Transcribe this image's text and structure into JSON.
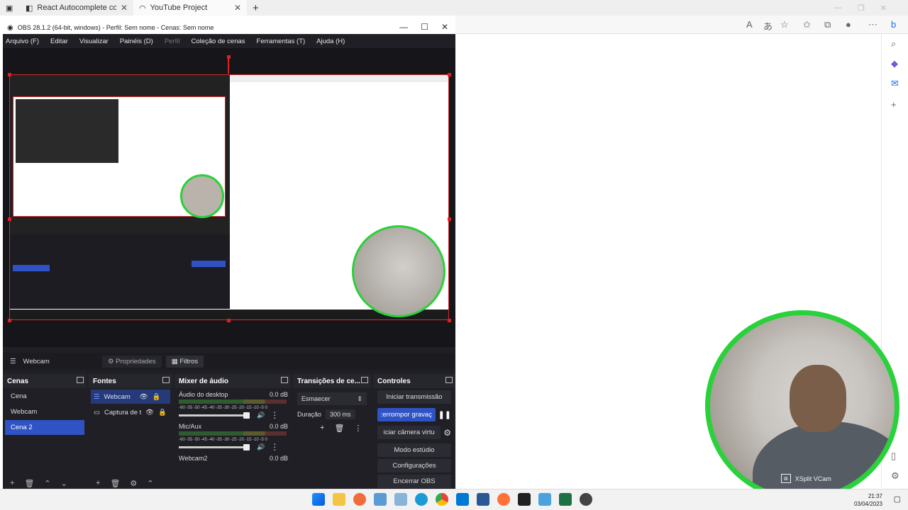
{
  "browser": {
    "tabs": [
      {
        "label": "React Autocomplete component",
        "active": false
      },
      {
        "label": "YouTube Project",
        "active": true
      }
    ]
  },
  "obs": {
    "title": "OBS 28.1.2 (64-bit, windows) - Perfil: Sem nome - Cenas: Sem nome",
    "menu": [
      "Arquivo (F)",
      "Editar",
      "Visualizar",
      "Painéis (D)",
      "Perfil",
      "Coleção de cenas",
      "Ferramentas (T)",
      "Ajuda (H)"
    ],
    "source_bar": {
      "current_source": "Webcam",
      "properties_label": "Propriedades",
      "filters_label": "Filtros"
    },
    "scenes": {
      "title": "Cenas",
      "items": [
        "Cena",
        "Webcam",
        "Cena 2"
      ],
      "selected": "Cena 2"
    },
    "sources": {
      "title": "Fontes",
      "items": [
        "Webcam",
        "Captura de t"
      ]
    },
    "mixer": {
      "title": "Mixer de áudio",
      "channels": [
        {
          "name": "Áudio do desktop",
          "level": "0.0 dB"
        },
        {
          "name": "Mic/Aux",
          "level": "0.0 dB"
        },
        {
          "name": "Webcam2",
          "level": "0.0 dB"
        }
      ],
      "scale": "-60 -55 -50 -45 -40 -35 -30 -25 -20 -15 -10 -5 0"
    },
    "transitions": {
      "title": "Transições de ce...",
      "selected": "Esmaecer",
      "duration_label": "Duração",
      "duration_value": "300 ms"
    },
    "controls": {
      "title": "Controles",
      "buttons": [
        "Iniciar transmissão",
        ":errompor gravaç",
        "iciar câmera virtu",
        "Modo estúdio",
        "Configurações",
        "Encerrar OBS"
      ]
    }
  },
  "webcam": {
    "overlay_label": "XSplit VCam",
    "border_color": "#29d13a"
  },
  "taskbar": {
    "time": "21:37",
    "date": "03/04/2023"
  }
}
